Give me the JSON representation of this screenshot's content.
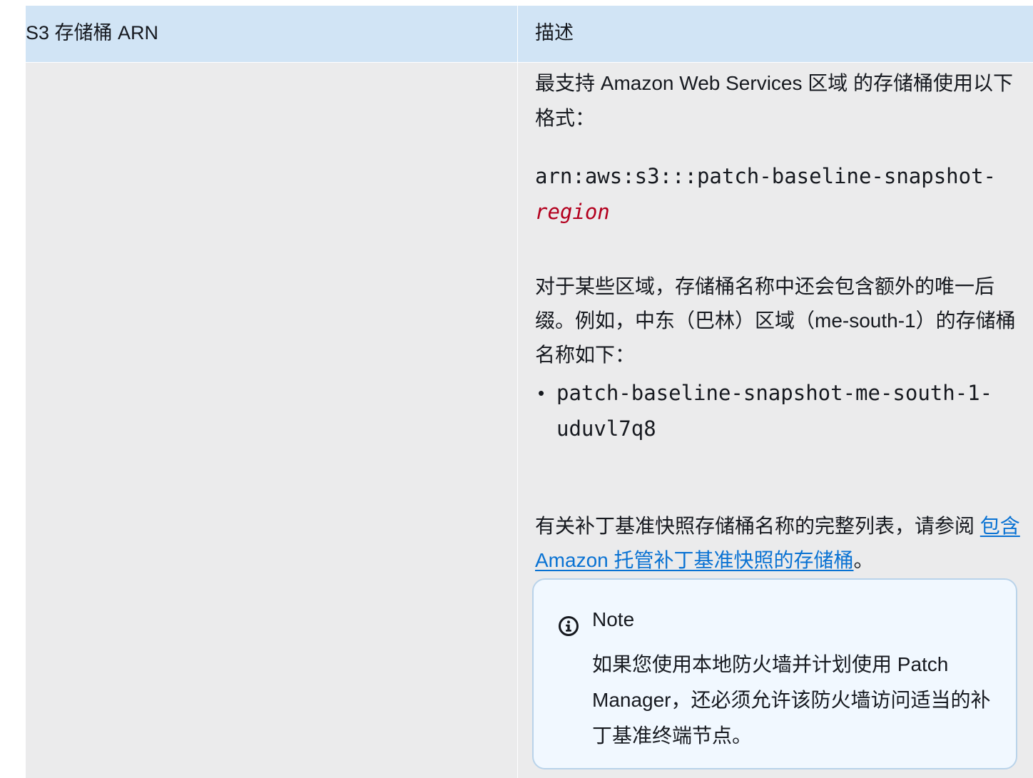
{
  "table": {
    "header": {
      "col1": "S3 存储桶 ARN",
      "col2": "描述"
    }
  },
  "description": {
    "intro": "最支持 Amazon Web Services 区域 的存储桶使用以下格式：",
    "arn_prefix": "arn:aws:s3:::patch-baseline-snapshot- ",
    "arn_variable": "region",
    "region_note": "对于某些区域，存储桶名称中还会包含额外的唯一后缀。例如，中东（巴林）区域（me-south-1）的存储桶名称如下：",
    "bucket_examples": [
      "patch-baseline-snapshot-me-south-1-uduvl7q8"
    ],
    "full_list_prefix": "有关补丁基准快照存储桶名称的完整列表，请参阅 ",
    "full_list_link": "包含 Amazon 托管补丁基准快照的存储桶",
    "full_list_suffix": "。"
  },
  "note": {
    "icon": "info-icon",
    "title": "Note",
    "body": "如果您使用本地防火墙并计划使用 Patch Manager，还必须允许该防火墙访问适当的补丁基准终端节点。"
  },
  "colors": {
    "header_bg": "#d1e4f5",
    "cell_bg": "#ebebec",
    "link": "#0972d3",
    "code_variable": "#b3001e",
    "note_bg": "#f1f8ff",
    "note_border": "#b9d3ea"
  }
}
